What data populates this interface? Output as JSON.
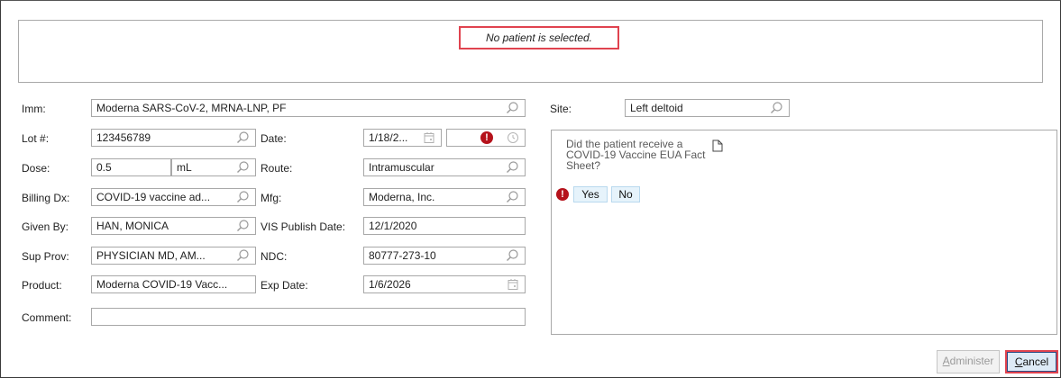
{
  "banner": {
    "message": "No patient is selected."
  },
  "form": {
    "imm": {
      "label": "Imm:",
      "value": "Moderna SARS-CoV-2, MRNA-LNP, PF"
    },
    "site": {
      "label": "Site:",
      "value": "Left deltoid"
    },
    "lot": {
      "label": "Lot #:",
      "value": "123456789"
    },
    "date": {
      "label": "Date:",
      "value": "1/18/2..."
    },
    "dose": {
      "label": "Dose:",
      "value": "0.5",
      "unit": "mL"
    },
    "route": {
      "label": "Route:",
      "value": "Intramuscular"
    },
    "billing_dx": {
      "label": "Billing Dx:",
      "value": "COVID-19 vaccine ad..."
    },
    "mfg": {
      "label": "Mfg:",
      "value": "Moderna, Inc."
    },
    "given_by": {
      "label": "Given By:",
      "value": "HAN, MONICA"
    },
    "vis_date": {
      "label": "VIS Publish Date:",
      "value": "12/1/2020"
    },
    "sup_prov": {
      "label": "Sup Prov:",
      "value": "PHYSICIAN MD, AM..."
    },
    "ndc": {
      "label": "NDC:",
      "value": "80777-273-10"
    },
    "product": {
      "label": "Product:",
      "value": "Moderna COVID-19 Vacc..."
    },
    "exp_date": {
      "label": "Exp Date:",
      "value": "1/6/2026"
    },
    "comment": {
      "label": "Comment:",
      "value": ""
    }
  },
  "question": {
    "text": "Did the patient receive a COVID-19 Vaccine EUA Fact Sheet?",
    "yes": "Yes",
    "no": "No"
  },
  "buttons": {
    "administer_first": "A",
    "administer_rest": "dminister",
    "cancel_first": "C",
    "cancel_rest": "ancel"
  },
  "colors": {
    "highlight_border": "#e0434f",
    "alert_red": "#b5121b",
    "yes_no_bg": "#e6f3fb"
  },
  "icons": [
    "magnifier-icon",
    "calendar-icon",
    "clock-icon",
    "alert-icon",
    "document-icon"
  ]
}
